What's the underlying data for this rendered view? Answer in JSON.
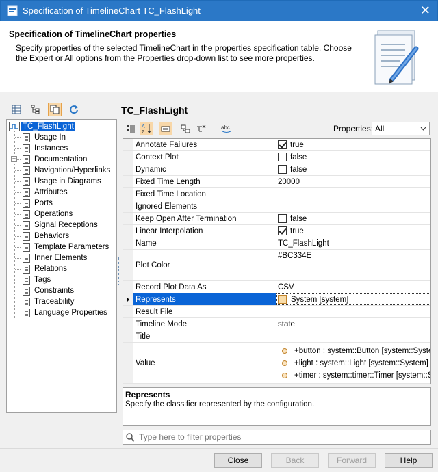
{
  "window": {
    "title": "Specification of TimelineChart TC_FlashLight"
  },
  "header": {
    "title": "Specification of TimelineChart properties",
    "description": "Specify properties of the selected TimelineChart in the properties specification table. Choose the Expert or All options from the Properties drop-down list to see more properties."
  },
  "tree": {
    "root": "TC_FlashLight",
    "items": [
      {
        "label": "Usage In"
      },
      {
        "label": "Instances"
      },
      {
        "label": "Documentation",
        "expandable": true
      },
      {
        "label": "Navigation/Hyperlinks"
      },
      {
        "label": "Usage in Diagrams"
      },
      {
        "label": "Attributes"
      },
      {
        "label": "Ports"
      },
      {
        "label": "Operations"
      },
      {
        "label": "Signal Receptions"
      },
      {
        "label": "Behaviors"
      },
      {
        "label": "Template Parameters"
      },
      {
        "label": "Inner Elements"
      },
      {
        "label": "Relations"
      },
      {
        "label": "Tags"
      },
      {
        "label": "Constraints"
      },
      {
        "label": "Traceability"
      },
      {
        "label": "Language Properties"
      }
    ]
  },
  "panel": {
    "title": "TC_FlashLight",
    "properties_label": "Properties:",
    "properties_value": "All"
  },
  "properties": {
    "rows": [
      {
        "name": "Annotate Failures",
        "value": "true",
        "checkbox": "on"
      },
      {
        "name": "Context Plot",
        "value": "false",
        "checkbox": "off"
      },
      {
        "name": "Dynamic",
        "value": "false",
        "checkbox": "off"
      },
      {
        "name": "Fixed Time Length",
        "value": "20000"
      },
      {
        "name": "Fixed Time Location",
        "value": ""
      },
      {
        "name": "Ignored Elements",
        "value": ""
      },
      {
        "name": "Keep Open After Termination",
        "value": "false",
        "checkbox": "off"
      },
      {
        "name": "Linear Interpolation",
        "value": "true",
        "checkbox": "on"
      },
      {
        "name": "Name",
        "value": "TC_FlashLight"
      },
      {
        "name": "Plot Color",
        "value": "#BC334E"
      },
      {
        "name": "Record Plot Data As",
        "value": "CSV"
      },
      {
        "name": "Represents",
        "value": "System [system]",
        "selected": true
      },
      {
        "name": "Result File",
        "value": ""
      },
      {
        "name": "Timeline Mode",
        "value": "state"
      },
      {
        "name": "Title",
        "value": ""
      },
      {
        "name": "Value",
        "values": [
          "+button : system::Button [system::Syste",
          "+light : system::Light [system::System]",
          "+timer : system::timer::Timer [system::Sy"
        ]
      }
    ]
  },
  "description": {
    "title": "Represents",
    "text": "Specify the classifier represented by the configuration."
  },
  "filter": {
    "placeholder": "Type here to filter properties"
  },
  "footer": {
    "close": "Close",
    "back": "Back",
    "forward": "Forward",
    "help": "Help"
  },
  "colors": {
    "titlebar": "#2b78c7",
    "selection": "#0a64d6",
    "active_tool": "#f8d7a8"
  },
  "icons": {
    "left_toolbar": [
      "table-view-icon",
      "tree-view-icon",
      "copy-icon",
      "refresh-icon"
    ],
    "right_toolbar": [
      "sort-categories-icon",
      "sort-alphabetical-icon",
      "active-filter-icon",
      "expand-icon",
      "collapse-icon",
      "abc-spell-icon"
    ]
  }
}
